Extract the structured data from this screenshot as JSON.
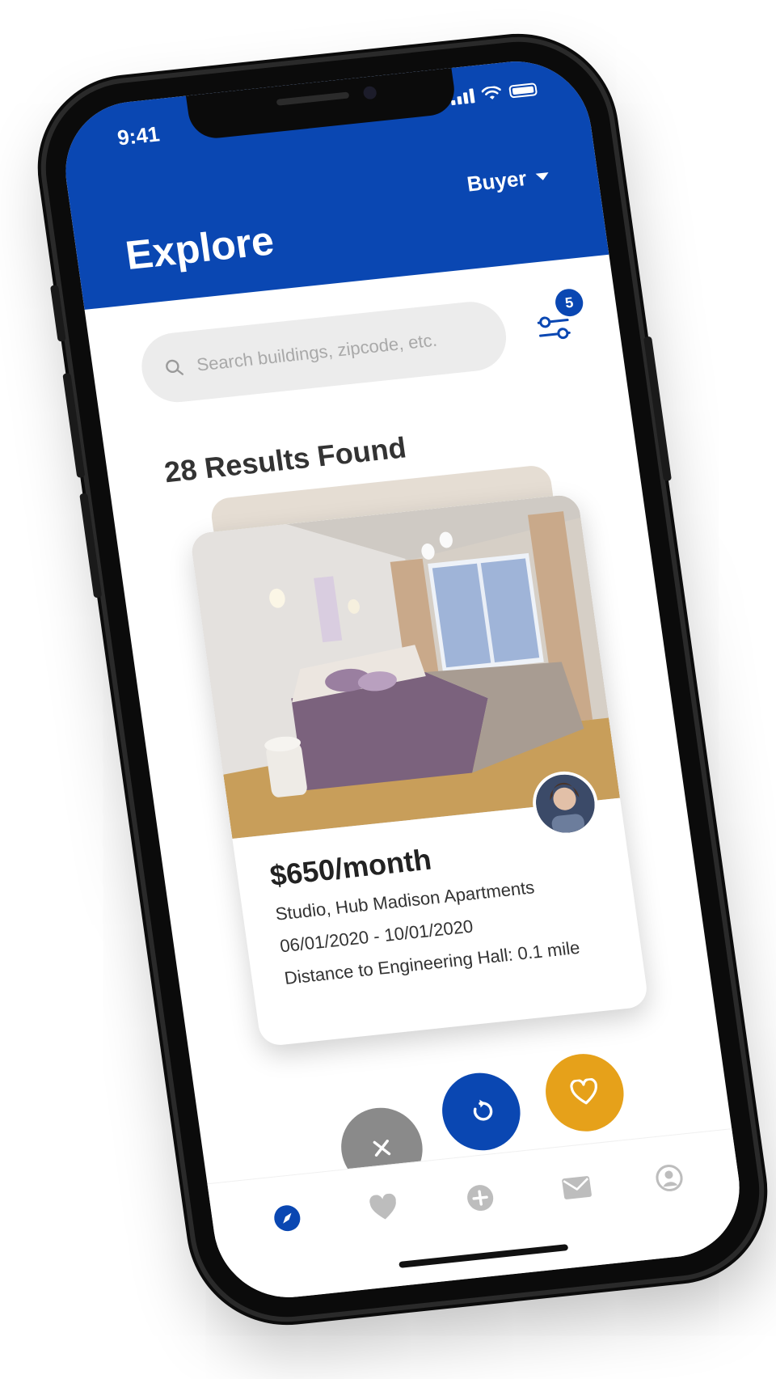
{
  "status_bar": {
    "time": "9:41"
  },
  "header": {
    "role_select": "Buyer",
    "title": "Explore",
    "background": "#0a47b2"
  },
  "search": {
    "placeholder": "Search buildings, zipcode, etc.",
    "value": "",
    "filter_badge_count": "5"
  },
  "results": {
    "count_label": "28 Results Found"
  },
  "listing": {
    "price": "$650/month",
    "type_and_building": "Studio, Hub Madison Apartments",
    "date_range": "06/01/2020 - 10/01/2020",
    "distance": "Distance to Engineering Hall: 0.1 mile"
  },
  "actions": {
    "pass_color": "#8a8a8a",
    "undo_color": "#0a47b2",
    "like_color": "#e6a11a"
  },
  "tabbar": {
    "items": [
      {
        "icon": "compass-icon",
        "active": true
      },
      {
        "icon": "heart-icon",
        "active": false
      },
      {
        "icon": "plus-circle-icon",
        "active": false
      },
      {
        "icon": "mail-icon",
        "active": false
      },
      {
        "icon": "profile-icon",
        "active": false
      }
    ],
    "active_color": "#0a47b2",
    "inactive_color": "#bdbdbd"
  }
}
